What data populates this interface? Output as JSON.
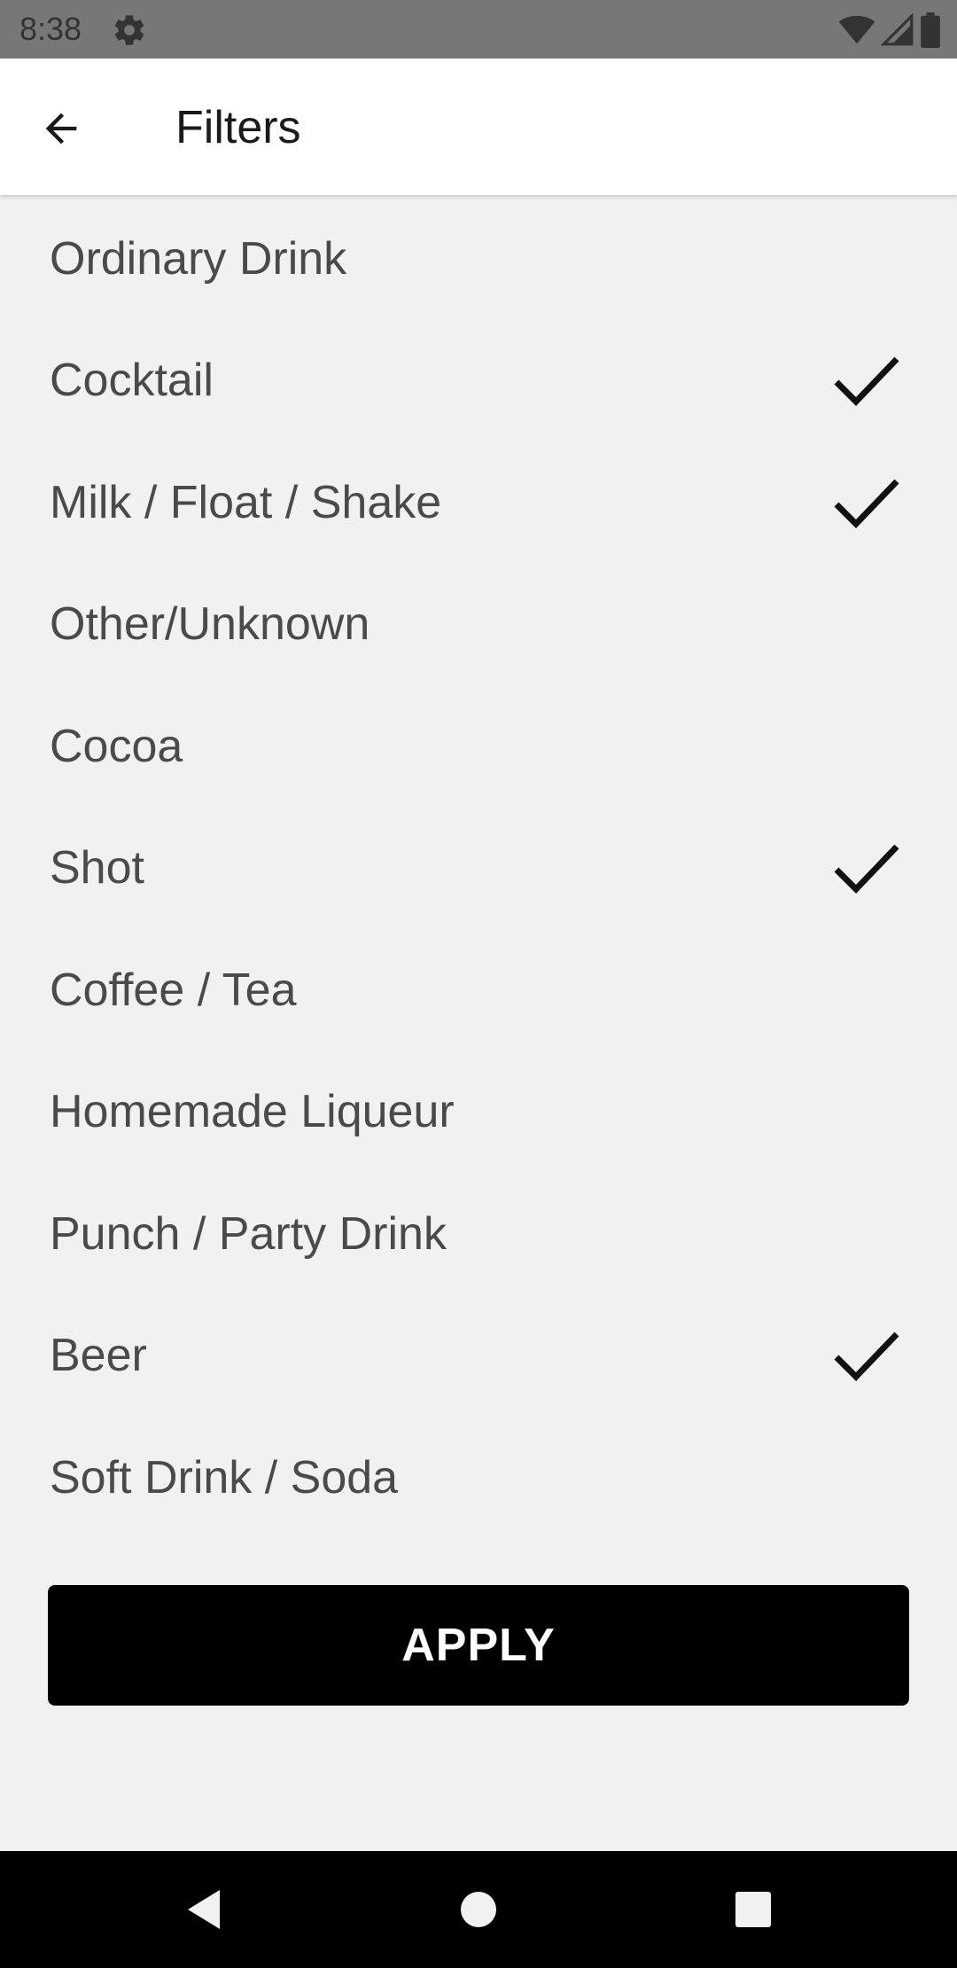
{
  "status_bar": {
    "time": "8:38",
    "icons": [
      "gear-icon",
      "wifi-icon",
      "signal-icon",
      "battery-icon"
    ]
  },
  "app_bar": {
    "title": "Filters",
    "back_icon": "arrow-back-icon"
  },
  "filters": [
    {
      "label": "Ordinary Drink",
      "checked": false
    },
    {
      "label": "Cocktail",
      "checked": true
    },
    {
      "label": "Milk / Float / Shake",
      "checked": true
    },
    {
      "label": "Other/Unknown",
      "checked": false
    },
    {
      "label": "Cocoa",
      "checked": false
    },
    {
      "label": "Shot",
      "checked": true
    },
    {
      "label": "Coffee / Tea",
      "checked": false
    },
    {
      "label": "Homemade Liqueur",
      "checked": false
    },
    {
      "label": "Punch / Party Drink",
      "checked": false
    },
    {
      "label": "Beer",
      "checked": true
    },
    {
      "label": "Soft Drink / Soda",
      "checked": false
    }
  ],
  "apply_button": {
    "label": "APPLY"
  },
  "nav_bar": {
    "buttons": [
      "back-triangle-icon",
      "home-circle-icon",
      "recents-square-icon"
    ]
  },
  "colors": {
    "background": "#f1f1f1",
    "app_bar": "#ffffff",
    "status_bar": "#777777",
    "button": "#000000",
    "text": "#4a4a4a"
  }
}
